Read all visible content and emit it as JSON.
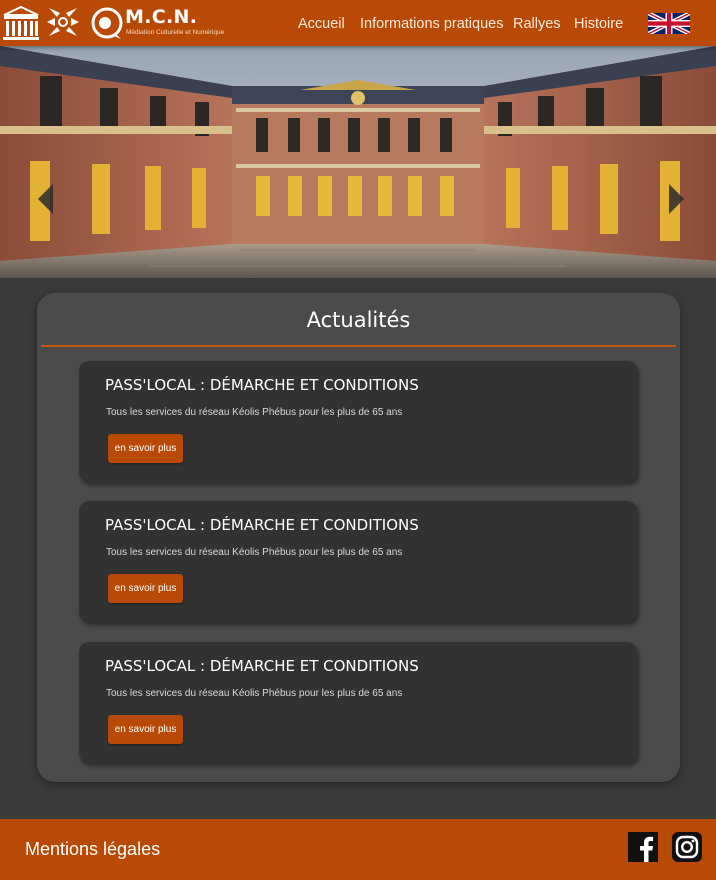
{
  "brand": {
    "name": "M.C.N.",
    "tagline": "Médiation Culturelle et Numérique"
  },
  "nav": {
    "items": [
      "Accueil",
      "Informations pratiques",
      "Rallyes",
      "Histoire"
    ],
    "language_icon": "uk-flag-icon"
  },
  "hero": {
    "prev_icon": "chevron-left-icon",
    "next_icon": "chevron-right-icon"
  },
  "news": {
    "title": "Actualités",
    "cards": [
      {
        "title": "PASS'LOCAL : DÉMARCHE ET CONDITIONS",
        "text": "Tous les services du réseau Kéolis Phébus pour les plus de 65 ans",
        "button": "en savoir plus"
      },
      {
        "title": "PASS'LOCAL : DÉMARCHE ET CONDITIONS",
        "text": "Tous les services du réseau Kéolis Phébus pour les plus de 65 ans",
        "button": "en savoir plus"
      },
      {
        "title": "PASS'LOCAL : DÉMARCHE ET CONDITIONS",
        "text": "Tous les services du réseau Kéolis Phébus pour les plus de 65 ans",
        "button": "en savoir plus"
      }
    ]
  },
  "footer": {
    "legal": "Mentions légales",
    "social_icons": [
      "facebook-icon",
      "instagram-icon"
    ]
  },
  "colors": {
    "brand": "#b84a06",
    "page_bg": "#3a3a3a",
    "panel_bg": "#4b4b4b",
    "card_bg": "#323232"
  }
}
